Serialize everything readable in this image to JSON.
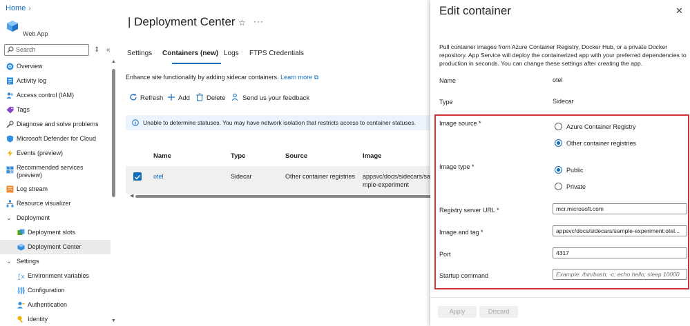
{
  "breadcrumb": {
    "home": "Home"
  },
  "app": {
    "type": "Web App"
  },
  "sidebar": {
    "search_placeholder": "Search",
    "items": [
      {
        "label": "Overview"
      },
      {
        "label": "Activity log"
      },
      {
        "label": "Access control (IAM)"
      },
      {
        "label": "Tags"
      },
      {
        "label": "Diagnose and solve problems"
      },
      {
        "label": "Microsoft Defender for Cloud"
      },
      {
        "label": "Events (preview)"
      },
      {
        "label": "Recommended services",
        "label2": "(preview)"
      },
      {
        "label": "Log stream"
      },
      {
        "label": "Resource visualizer"
      },
      {
        "label": "Deployment"
      },
      {
        "label": "Deployment slots"
      },
      {
        "label": "Deployment Center"
      },
      {
        "label": "Settings"
      },
      {
        "label": "Environment variables"
      },
      {
        "label": "Configuration"
      },
      {
        "label": "Authentication"
      },
      {
        "label": "Identity"
      }
    ]
  },
  "main": {
    "title": "| Deployment Center",
    "tabs": [
      {
        "label": "Settings"
      },
      {
        "label": "Containers (new)"
      },
      {
        "label": "Logs"
      },
      {
        "label": "FTPS Credentials"
      }
    ],
    "intro": "Enhance site functionality by adding sidecar containers.",
    "learn_more": "Learn more",
    "toolbar": {
      "refresh": "Refresh",
      "add": "Add",
      "delete": "Delete",
      "feedback": "Send us your feedback"
    },
    "banner": "Unable to determine statuses. You may have network isolation that restricts access to container statuses.",
    "columns": {
      "name": "Name",
      "type": "Type",
      "source": "Source",
      "image": "Image"
    },
    "rows": [
      {
        "name": "otel",
        "type": "Sidecar",
        "source": "Other container registries",
        "image_1": "appsvc/docs/sidecars/sa",
        "image_2": "mple-experiment"
      }
    ]
  },
  "panel": {
    "title": "Edit container",
    "description": "Pull container images from Azure Container Registry, Docker Hub, or a private Docker repository. App Service will deploy the containerized app with your preferred dependencies to production in seconds. You can change these settings after creating the app.",
    "name_label": "Name",
    "name_value": "otel",
    "type_label": "Type",
    "type_value": "Sidecar",
    "image_source_label": "Image source *",
    "image_source_options": [
      "Azure Container Registry",
      "Other container registries"
    ],
    "image_source_selected": "Other container registries",
    "image_type_label": "Image type *",
    "image_type_options": [
      "Public",
      "Private"
    ],
    "image_type_selected": "Public",
    "registry_label": "Registry server URL *",
    "registry_value": "mcr.microsoft.com",
    "image_tag_label": "Image and tag *",
    "image_tag_value": "appsvc/docs/sidecars/sample-experiment:otel...",
    "port_label": "Port",
    "port_value": "4317",
    "startup_label": "Startup command",
    "startup_placeholder": "Example: /bin/bash; -c; echo hello; sleep 10000",
    "apply": "Apply",
    "discard": "Discard"
  },
  "colors": {
    "accent": "#0f6cbd",
    "highlight": "#d13438"
  }
}
